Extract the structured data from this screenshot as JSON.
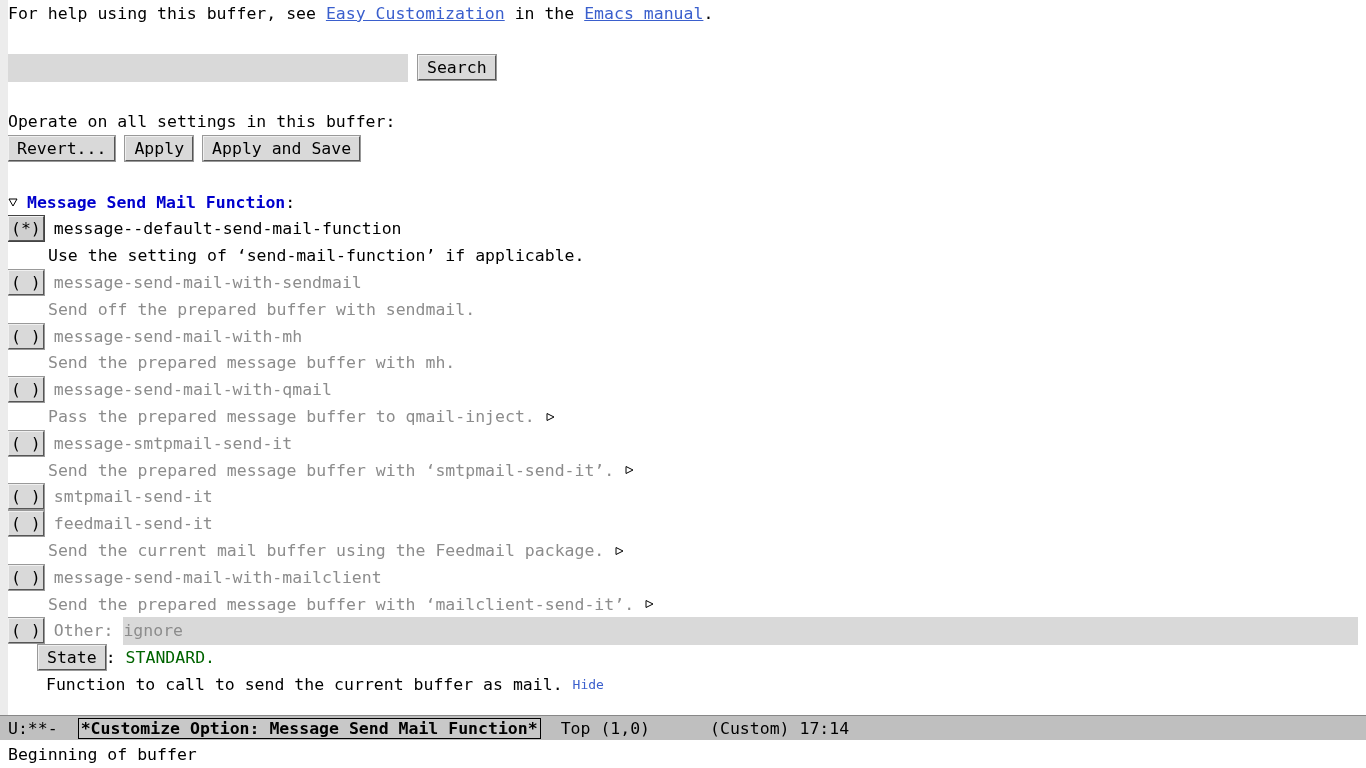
{
  "help": {
    "before": "For help using this buffer, see ",
    "link1": "Easy Customization",
    "middle": " in the ",
    "link2": "Emacs manual",
    "after": "."
  },
  "search": {
    "button": "Search"
  },
  "operate": {
    "label": "Operate on all settings in this buffer:",
    "buttons": [
      "Revert...",
      "Apply",
      "Apply and Save"
    ]
  },
  "option": {
    "expanded": true,
    "title": "Message Send Mail Function",
    "colon": ":",
    "choices": [
      {
        "marker": "(*)",
        "selected": true,
        "name": "message--default-send-mail-function",
        "description": "Use the setting of ‘send-mail-function’ if applicable."
      },
      {
        "marker": "( )",
        "selected": false,
        "name": "message-send-mail-with-sendmail",
        "description": "Send off the prepared buffer with sendmail."
      },
      {
        "marker": "( )",
        "selected": false,
        "name": "message-send-mail-with-mh",
        "description": "Send the prepared message buffer with mh."
      },
      {
        "marker": "( )",
        "selected": false,
        "name": "message-send-mail-with-qmail",
        "description": "Pass the prepared message buffer to qmail-inject.",
        "more": true
      },
      {
        "marker": "( )",
        "selected": false,
        "name": "message-smtpmail-send-it",
        "description": "Send the prepared message buffer with ‘smtpmail-send-it’.",
        "more": true
      },
      {
        "marker": "( )",
        "selected": false,
        "name": "smtpmail-send-it"
      },
      {
        "marker": "( )",
        "selected": false,
        "name": "feedmail-send-it",
        "description": "Send the current mail buffer using the Feedmail package.",
        "more": true
      },
      {
        "marker": "( )",
        "selected": false,
        "name": "message-send-mail-with-mailclient",
        "description": "Send the prepared message buffer with ‘mailclient-send-it’.",
        "more": true
      }
    ],
    "other": {
      "marker": "( )",
      "selected": false,
      "label": "Other:",
      "value": "ignore"
    },
    "state": {
      "button": "State",
      "colon": ":",
      "text": "STANDARD."
    },
    "doc": {
      "text": "Function to call to send the current buffer as mail.",
      "hide": "Hide"
    }
  },
  "mode_line": {
    "status": "U:**-",
    "buffer": "*Customize Option: Message Send Mail Function*",
    "position": "Top (1,0)",
    "mode": "(Custom) 17:14"
  },
  "echo_area": "Beginning of buffer"
}
